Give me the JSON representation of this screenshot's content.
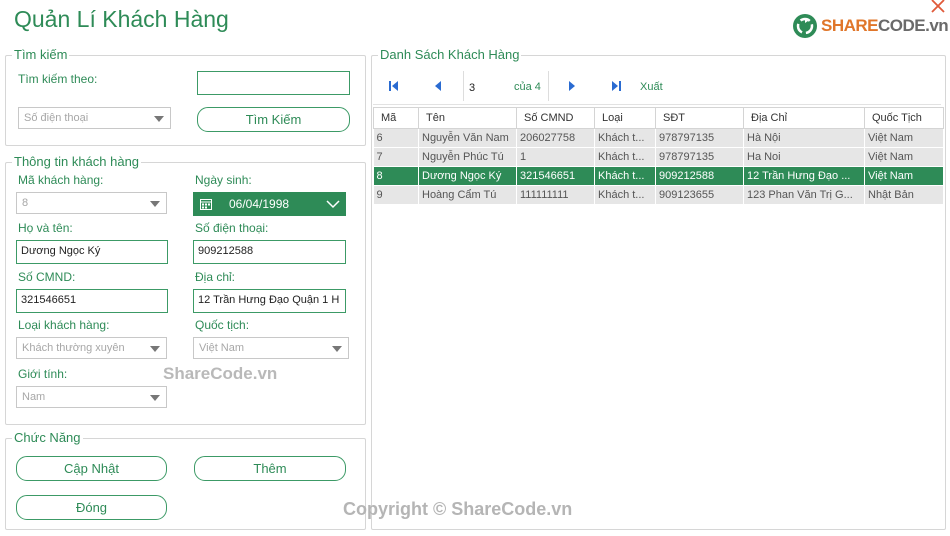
{
  "window": {
    "title": "Quản Lí Khách Hàng",
    "logo_brand_part": "SHARE",
    "logo_suffix_part": "CODE.vn"
  },
  "search": {
    "legend": "Tìm kiếm",
    "by_label": "Tìm kiếm theo:",
    "input_value": "",
    "field_select": "Số điện thoại",
    "button": "Tìm Kiếm"
  },
  "info": {
    "legend": "Thông tin khách hàng",
    "customer_id_label": "Mã khách hàng:",
    "customer_id": "8",
    "dob_label": "Ngày sinh:",
    "dob": "06/04/1998",
    "name_label": "Họ và tên:",
    "name": "Dương Ngọc Ký",
    "phone_label": "Số điện thoại:",
    "phone": "909212588",
    "id_card_label": "Số CMND:",
    "id_card": "321546651",
    "address_label": "Địa chỉ:",
    "address": "12 Trần Hưng Đạo Quận 1 H",
    "type_label": "Loại khách hàng:",
    "type": "Khách thường xuyên",
    "nationality_label": "Quốc tịch:",
    "nationality": "Việt Nam",
    "gender_label": "Giới tính:",
    "gender": "Nam"
  },
  "functions": {
    "legend": "Chức Năng",
    "update": "Cập Nhật",
    "add": "Thêm",
    "close": "Đóng"
  },
  "list": {
    "legend": "Danh Sách Khách Hàng",
    "current_page": "3",
    "page_of": "của 4",
    "export": "Xuất",
    "columns": [
      "Mã",
      "Tên",
      "Số CMND",
      "Loại",
      "SĐT",
      "Địa Chỉ",
      "Quốc Tịch"
    ],
    "rows": [
      [
        "6",
        "Nguyễn Văn Nam",
        "206027758",
        "Khách t...",
        "978797135",
        "Hà Nội",
        "Việt Nam"
      ],
      [
        "7",
        "Nguyễn Phúc Tú",
        "1",
        "Khách t...",
        "978797135",
        "Ha Noi",
        "Việt Nam"
      ],
      [
        "8",
        "Dương Ngọc Ký",
        "321546651",
        "Khách t...",
        "909212588",
        "12 Trần Hưng Đạo ...",
        "Việt Nam"
      ],
      [
        "9",
        "Hoàng Cẩm Tú",
        "111111111",
        "Khách t...",
        "909123655",
        "123 Phan Văn Trị G...",
        "Nhật Bản"
      ]
    ],
    "selected_row": 2
  },
  "watermarks": {
    "center": "ShareCode.vn",
    "bottom": "Copyright © ShareCode.vn"
  },
  "colors": {
    "accent": "#2e8b57",
    "close": "#e05a3a",
    "logo_orange": "#e0762a"
  },
  "icons": {
    "first": "first-page-icon",
    "prev": "previous-page-icon",
    "next": "next-page-icon",
    "last": "last-page-icon",
    "calendar": "calendar-icon",
    "close": "close-icon"
  }
}
